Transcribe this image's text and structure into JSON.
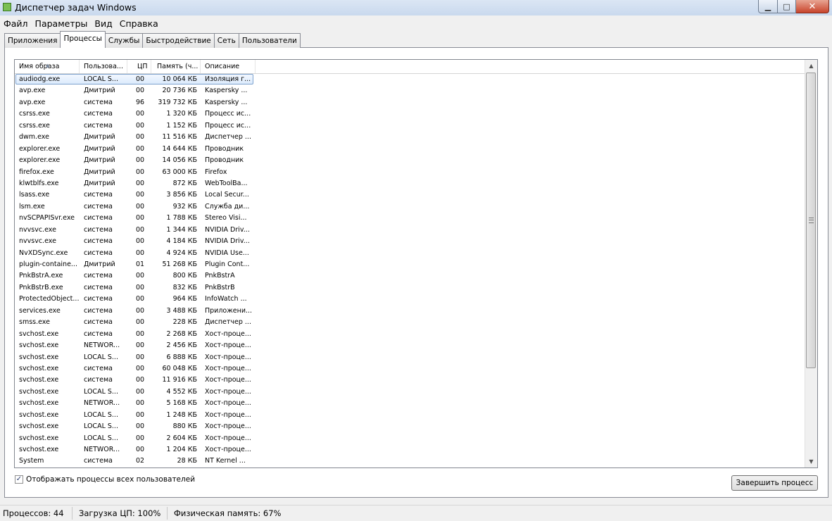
{
  "window": {
    "title": "Диспетчер задач Windows",
    "min_glyph": "▁",
    "max_glyph": "□",
    "close_glyph": "✕"
  },
  "menu": [
    "Файл",
    "Параметры",
    "Вид",
    "Справка"
  ],
  "tabs": [
    {
      "label": "Приложения",
      "active": false
    },
    {
      "label": "Процессы",
      "active": true
    },
    {
      "label": "Службы",
      "active": false
    },
    {
      "label": "Быстродействие",
      "active": false
    },
    {
      "label": "Сеть",
      "active": false
    },
    {
      "label": "Пользователи",
      "active": false
    }
  ],
  "table": {
    "headers": [
      "Имя образа",
      "Пользова...",
      "ЦП",
      "Память (ч...",
      "Описание"
    ],
    "sort_glyph": "▲",
    "rows": [
      [
        "audiodg.exe",
        "LOCAL S...",
        "00",
        "10 064 КБ",
        "Изоляция г..."
      ],
      [
        "avp.exe",
        "Дмитрий",
        "00",
        "20 736 КБ",
        "Kaspersky ..."
      ],
      [
        "avp.exe",
        "система",
        "96",
        "319 732 КБ",
        "Kaspersky ..."
      ],
      [
        "csrss.exe",
        "система",
        "00",
        "1 320 КБ",
        "Процесс ис..."
      ],
      [
        "csrss.exe",
        "система",
        "00",
        "1 152 КБ",
        "Процесс ис..."
      ],
      [
        "dwm.exe",
        "Дмитрий",
        "00",
        "11 516 КБ",
        "Диспетчер ..."
      ],
      [
        "explorer.exe",
        "Дмитрий",
        "00",
        "14 644 КБ",
        "Проводник"
      ],
      [
        "explorer.exe",
        "Дмитрий",
        "00",
        "14 056 КБ",
        "Проводник"
      ],
      [
        "firefox.exe",
        "Дмитрий",
        "00",
        "63 000 КБ",
        "Firefox"
      ],
      [
        "klwtblfs.exe",
        "Дмитрий",
        "00",
        "872 КБ",
        "WebToolBa..."
      ],
      [
        "lsass.exe",
        "система",
        "00",
        "3 856 КБ",
        "Local Secur..."
      ],
      [
        "lsm.exe",
        "система",
        "00",
        "932 КБ",
        "Служба ди..."
      ],
      [
        "nvSCPAPISvr.exe",
        "система",
        "00",
        "1 788 КБ",
        "Stereo Visi..."
      ],
      [
        "nvvsvc.exe",
        "система",
        "00",
        "1 344 КБ",
        "NVIDIA Driv..."
      ],
      [
        "nvvsvc.exe",
        "система",
        "00",
        "4 184 КБ",
        "NVIDIA Driv..."
      ],
      [
        "NvXDSync.exe",
        "система",
        "00",
        "4 924 КБ",
        "NVIDIA Use..."
      ],
      [
        "plugin-containe...",
        "Дмитрий",
        "01",
        "51 268 КБ",
        "Plugin Cont..."
      ],
      [
        "PnkBstrA.exe",
        "система",
        "00",
        "800 КБ",
        "PnkBstrA"
      ],
      [
        "PnkBstrB.exe",
        "система",
        "00",
        "832 КБ",
        "PnkBstrB"
      ],
      [
        "ProtectedObject...",
        "система",
        "00",
        "964 КБ",
        "InfoWatch ..."
      ],
      [
        "services.exe",
        "система",
        "00",
        "3 488 КБ",
        "Приложени..."
      ],
      [
        "smss.exe",
        "система",
        "00",
        "228 КБ",
        "Диспетчер ..."
      ],
      [
        "svchost.exe",
        "система",
        "00",
        "2 268 КБ",
        "Хост-проце..."
      ],
      [
        "svchost.exe",
        "NETWOR...",
        "00",
        "2 456 КБ",
        "Хост-проце..."
      ],
      [
        "svchost.exe",
        "LOCAL S...",
        "00",
        "6 888 КБ",
        "Хост-проце..."
      ],
      [
        "svchost.exe",
        "система",
        "00",
        "60 048 КБ",
        "Хост-проце..."
      ],
      [
        "svchost.exe",
        "система",
        "00",
        "11 916 КБ",
        "Хост-проце..."
      ],
      [
        "svchost.exe",
        "LOCAL S...",
        "00",
        "4 552 КБ",
        "Хост-проце..."
      ],
      [
        "svchost.exe",
        "NETWOR...",
        "00",
        "5 168 КБ",
        "Хост-проце..."
      ],
      [
        "svchost.exe",
        "LOCAL S...",
        "00",
        "1 248 КБ",
        "Хост-проце..."
      ],
      [
        "svchost.exe",
        "LOCAL S...",
        "00",
        "880 КБ",
        "Хост-проце..."
      ],
      [
        "svchost.exe",
        "LOCAL S...",
        "00",
        "2 604 КБ",
        "Хост-проце..."
      ],
      [
        "svchost.exe",
        "NETWOR...",
        "00",
        "1 204 КБ",
        "Хост-проце..."
      ],
      [
        "System",
        "система",
        "02",
        "28 КБ",
        "NT Kernel ..."
      ]
    ],
    "selected_row": 0
  },
  "scrollbar": {
    "up_glyph": "▲",
    "down_glyph": "▼"
  },
  "show_all": {
    "label": "Отображать процессы всех пользователей",
    "checked": true,
    "glyph": "✓"
  },
  "end_button": "Завершить процесс",
  "status": {
    "processes": "Процессов: 44",
    "cpu": "Загрузка ЦП: 100%",
    "memory": "Физическая память: 67%"
  },
  "colors": {
    "selection_border": "#7da2ce",
    "close_button": "#c8442b"
  }
}
